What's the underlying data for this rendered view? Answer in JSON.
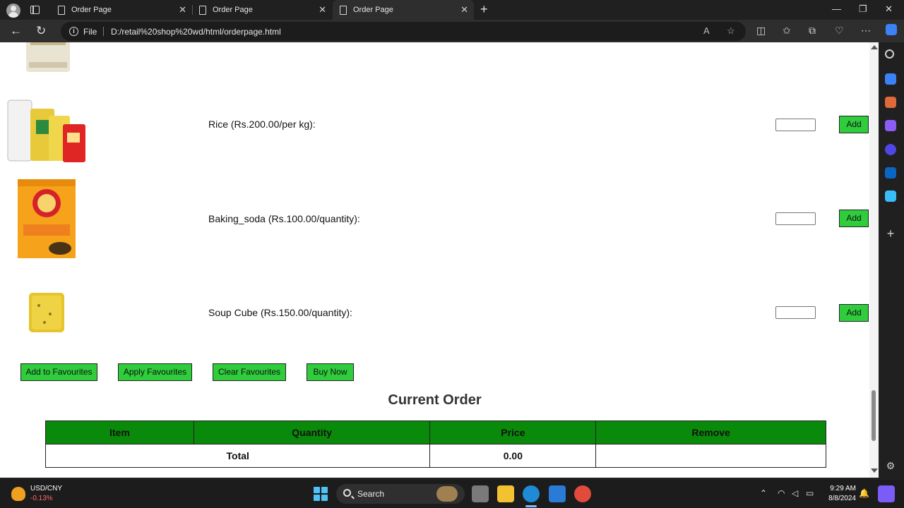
{
  "browser": {
    "tabs": [
      {
        "title": "Order Page",
        "active": false
      },
      {
        "title": "Order Page",
        "active": false
      },
      {
        "title": "Order Page",
        "active": true
      }
    ],
    "address": {
      "scheme_label": "File",
      "url": "D:/retail%20shop%20wd/html/orderpage.html"
    }
  },
  "products": [
    {
      "label": "Rice (Rs.200.00/per kg):",
      "add_label": "Add",
      "quantity": ""
    },
    {
      "label": "Baking_soda (Rs.100.00/quantity):",
      "add_label": "Add",
      "quantity": ""
    },
    {
      "label": "Soup Cube (Rs.150.00/quantity):",
      "add_label": "Add",
      "quantity": ""
    }
  ],
  "actions": {
    "add_to_favourites": "Add to Favourites",
    "apply_favourites": "Apply Favourites",
    "clear_favourites": "Clear Favourites",
    "buy_now": "Buy Now"
  },
  "order": {
    "title": "Current Order",
    "columns": [
      "Item",
      "Quantity",
      "Price",
      "Remove"
    ],
    "total_label": "Total",
    "total_value": "0.00"
  },
  "taskbar": {
    "widget_title": "USD/CNY",
    "widget_change": "-0.13%",
    "search_label": "Search",
    "time": "9:29 AM",
    "date": "8/8/2024"
  },
  "colors": {
    "button_green": "#2fcc3c",
    "table_header_green": "#0a8a0a",
    "browser_dark": "#202020"
  }
}
